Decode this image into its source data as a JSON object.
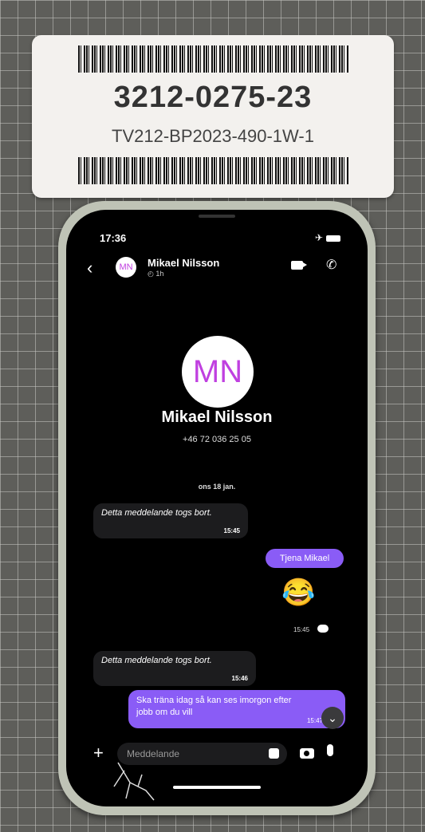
{
  "label": {
    "case_number": "3212-0275-23",
    "item_id": "TV212-BP2023-490-1W-1"
  },
  "status_bar": {
    "time": "17:36",
    "icons": "✈"
  },
  "header": {
    "back_glyph": "‹",
    "avatar_initials": "MN",
    "contact_name": "Mikael Nilsson",
    "disappearing_timer": "◴ 1h",
    "video_call_icon": "video-icon",
    "voice_call_icon": "phone-icon"
  },
  "profile": {
    "avatar_initials": "MN",
    "name": "Mikael Nilsson",
    "phone": "+46 72 036 25 05"
  },
  "conversation": {
    "date_separator": "ons 18 jan.",
    "messages": [
      {
        "direction": "incoming",
        "text": "Detta meddelande togs bort.",
        "time": "15:45"
      },
      {
        "direction": "outgoing",
        "text": "Tjena Mikael"
      },
      {
        "direction": "outgoing",
        "text": "😂",
        "time": "15:45"
      },
      {
        "direction": "incoming",
        "text": "Detta meddelande togs bort.",
        "time": "15:46"
      },
      {
        "direction": "outgoing",
        "text": "Ska träna idag så kan ses imorgon efter jobb om du vill",
        "time": "15:47"
      }
    ],
    "scroll_down_glyph": "⌄"
  },
  "composer": {
    "plus_glyph": "+",
    "placeholder": "Meddelande"
  },
  "colors": {
    "accent": "#8a5cf6",
    "avatar_text": "#c040e0",
    "incoming_bubble": "#1c1c1e"
  }
}
